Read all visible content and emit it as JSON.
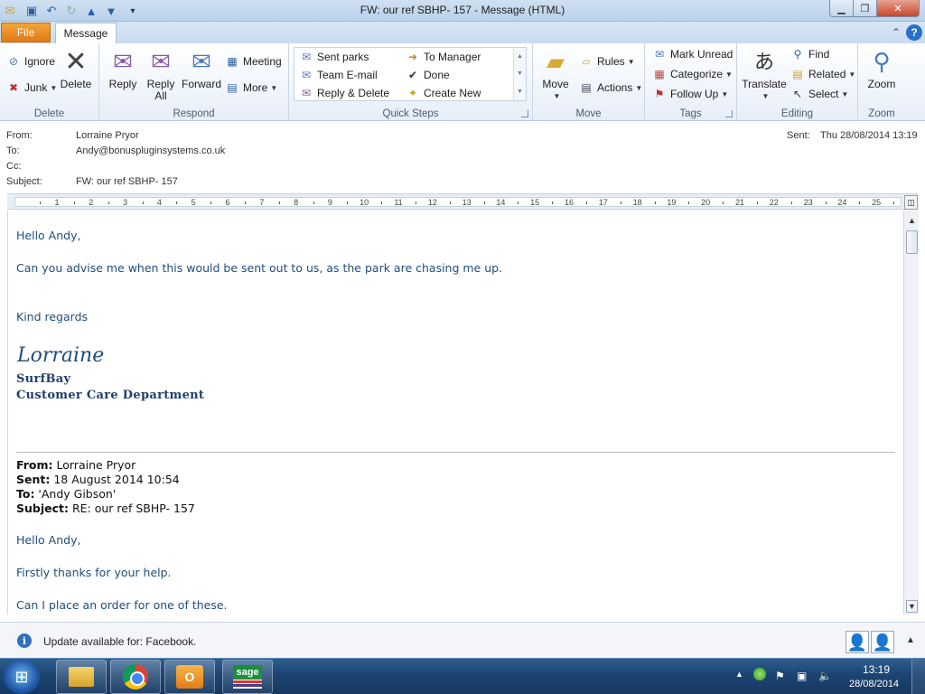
{
  "window": {
    "title": "FW: our ref SBHP- 157  -  Message (HTML)"
  },
  "tabs": {
    "file": "File",
    "message": "Message"
  },
  "ribbon": {
    "delete_group": {
      "label": "Delete",
      "ignore": "Ignore",
      "junk": "Junk",
      "delete": "Delete"
    },
    "respond_group": {
      "label": "Respond",
      "reply": "Reply",
      "reply_all_1": "Reply",
      "reply_all_2": "All",
      "forward": "Forward",
      "meeting": "Meeting",
      "more": "More"
    },
    "quicksteps_group": {
      "label": "Quick Steps",
      "items": [
        "Sent parks",
        "To Manager",
        "Team E-mail",
        "Done",
        "Reply & Delete",
        "Create New"
      ]
    },
    "move_group": {
      "label": "Move",
      "move": "Move",
      "rules": "Rules",
      "actions": "Actions"
    },
    "tags_group": {
      "label": "Tags",
      "mark_unread": "Mark Unread",
      "categorize": "Categorize",
      "follow_up": "Follow Up"
    },
    "editing_group": {
      "label": "Editing",
      "translate": "Translate",
      "find": "Find",
      "related": "Related",
      "select": "Select"
    },
    "zoom_group": {
      "label": "Zoom",
      "zoom": "Zoom"
    }
  },
  "header": {
    "from_label": "From:",
    "from_value": "Lorraine Pryor",
    "to_label": "To:",
    "to_value": "Andy@bonuspluginsystems.co.uk",
    "cc_label": "Cc:",
    "cc_value": "",
    "subject_label": "Subject:",
    "subject_value": "FW: our ref SBHP- 157",
    "sent_label": "Sent:",
    "sent_value": "Thu 28/08/2014 13:19"
  },
  "ruler": {
    "numbers": [
      "1",
      "2",
      "3",
      "4",
      "5",
      "6",
      "7",
      "8",
      "9",
      "10",
      "11",
      "12",
      "13",
      "14",
      "15",
      "16",
      "17",
      "18",
      "19",
      "20",
      "21",
      "22",
      "23",
      "24",
      "25"
    ]
  },
  "body": {
    "greeting": "Hello Andy,",
    "line1": "Can you advise me when this would be sent out to us, as the park are chasing me up.",
    "regards": "Kind regards",
    "sig_name": "Lorraine",
    "sig_org1": "SurfBay",
    "sig_org2": "Customer Care Department",
    "fw_from_label": "From:",
    "fw_from_value": " Lorraine Pryor",
    "fw_sent_label": "Sent:",
    "fw_sent_value": " 18 August 2014 10:54",
    "fw_to_label": "To:",
    "fw_to_value": " 'Andy Gibson'",
    "fw_subject_label": "Subject:",
    "fw_subject_value": " RE: our ref SBHP- 157",
    "fw_greeting": "Hello Andy,",
    "fw_line1": "Firstly thanks for your help.",
    "fw_line2": "Can I place an order for one of these."
  },
  "notification": {
    "text": "Update available for: Facebook."
  },
  "taskbar": {
    "outlook_letter": "O",
    "sage_label": "sage",
    "clock_time": "13:19",
    "clock_date": "28/08/2014"
  },
  "colors": {
    "body_text": "#1f4e79",
    "file_tab": "#e27a14",
    "taskbar": "#1d4472"
  }
}
